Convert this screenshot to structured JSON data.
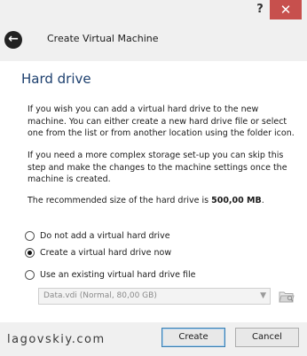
{
  "titlebar": {
    "help_label": "?",
    "close_label": "✕",
    "back_icon": "arrow-left-icon",
    "title": "Create Virtual Machine"
  },
  "page": {
    "section_title": "Hard drive",
    "paragraph1": "If you wish you can add a virtual hard drive to the new machine. You can either create a new hard drive file or select one from the list or from another location using the folder icon.",
    "paragraph2": "If you need a more complex storage set-up you can skip this step and make the changes to the machine settings once the machine is created.",
    "recommended_prefix": "The recommended size of the hard drive is ",
    "recommended_size": "500,00 MB",
    "recommended_suffix": "."
  },
  "options": [
    {
      "label": "Do not add a virtual hard drive",
      "checked": false
    },
    {
      "label": "Create a virtual hard drive now",
      "checked": true
    },
    {
      "label": "Use an existing virtual hard drive file",
      "checked": false
    }
  ],
  "existing_file": {
    "value": "Data.vdi (Normal, 80,00 GB)",
    "enabled": false,
    "folder_icon": "folder-browse-icon"
  },
  "footer": {
    "watermark": "lagovskiy.com",
    "create_label": "Create",
    "cancel_label": "Cancel"
  },
  "colors": {
    "title_accent": "#1c3f6e",
    "close_button": "#c7504d",
    "default_button_border": "#3c7fb1"
  }
}
